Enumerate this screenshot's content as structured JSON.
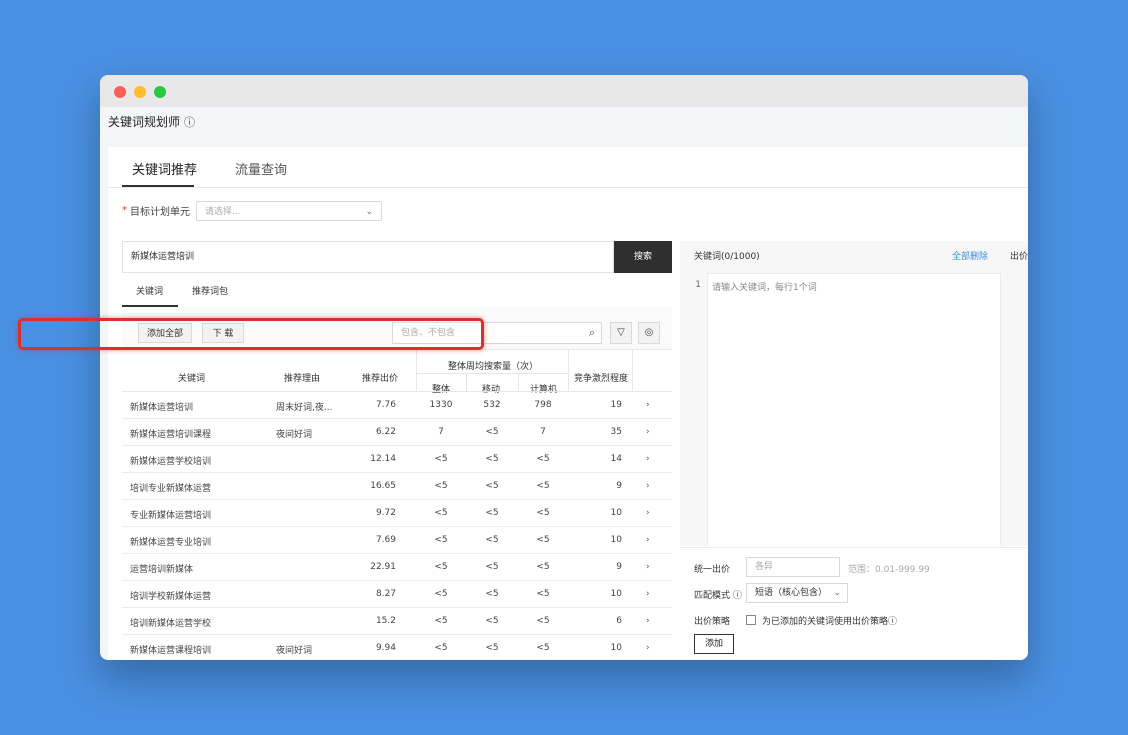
{
  "app": {
    "title": "关键词规划师"
  },
  "tabs": [
    {
      "label": "关键词推荐"
    },
    {
      "label": "流量查询"
    }
  ],
  "target": {
    "label": "目标计划单元",
    "placeholder": "请选择..."
  },
  "search": {
    "value": "新媒体运营培训",
    "button": "搜索"
  },
  "subtabs": [
    {
      "label": "关键词"
    },
    {
      "label": "推荐词包"
    }
  ],
  "toolbar": {
    "add_all": "添加全部",
    "download": "下 载",
    "filter_placeholder": "包含、不包含"
  },
  "table": {
    "headers": {
      "keyword": "关键词",
      "reason": "推荐理由",
      "bid": "推荐出价",
      "weekly": "整体周均搜索量（次）",
      "total": "整体",
      "mobile": "移动",
      "pc": "计算机",
      "competition": "竞争激烈程度"
    },
    "rows": [
      {
        "keyword": "新媒体运营培训",
        "reason": "周末好词,夜...",
        "bid": "7.76",
        "total": "1330",
        "mobile": "532",
        "pc": "798",
        "competition": "19"
      },
      {
        "keyword": "新媒体运营培训课程",
        "reason": "夜间好词",
        "bid": "6.22",
        "total": "7",
        "mobile": "<5",
        "pc": "7",
        "competition": "35"
      },
      {
        "keyword": "新媒体运营学校培训",
        "reason": "",
        "bid": "12.14",
        "total": "<5",
        "mobile": "<5",
        "pc": "<5",
        "competition": "14"
      },
      {
        "keyword": "培训专业新媒体运营",
        "reason": "",
        "bid": "16.65",
        "total": "<5",
        "mobile": "<5",
        "pc": "<5",
        "competition": "9"
      },
      {
        "keyword": "专业新媒体运营培训",
        "reason": "",
        "bid": "9.72",
        "total": "<5",
        "mobile": "<5",
        "pc": "<5",
        "competition": "10"
      },
      {
        "keyword": "新媒体运营专业培训",
        "reason": "",
        "bid": "7.69",
        "total": "<5",
        "mobile": "<5",
        "pc": "<5",
        "competition": "10"
      },
      {
        "keyword": "运营培训新媒体",
        "reason": "",
        "bid": "22.91",
        "total": "<5",
        "mobile": "<5",
        "pc": "<5",
        "competition": "9"
      },
      {
        "keyword": "培训学校新媒体运营",
        "reason": "",
        "bid": "8.27",
        "total": "<5",
        "mobile": "<5",
        "pc": "<5",
        "competition": "10"
      },
      {
        "keyword": "培训新媒体运营学校",
        "reason": "",
        "bid": "15.2",
        "total": "<5",
        "mobile": "<5",
        "pc": "<5",
        "competition": "6"
      },
      {
        "keyword": "新媒体运营课程培训",
        "reason": "夜间好词",
        "bid": "9.94",
        "total": "<5",
        "mobile": "<5",
        "pc": "<5",
        "competition": "10"
      }
    ]
  },
  "right": {
    "header": "关键词(0/1000)",
    "clear_all": "全部删除",
    "bid_col": "出价",
    "line_no": "1",
    "editor_placeholder": "请输入关键词，每行1个词",
    "unified_bid_label": "统一出价",
    "unified_bid_placeholder": "各异",
    "range": "范围：0.01-999.99",
    "match_label": "匹配模式",
    "match_value": "短语（核心包含）",
    "strategy_label": "出价策略",
    "strategy_text": "为已添加的关键词使用出价策略",
    "add": "添加"
  },
  "icons": {
    "info": "info-icon",
    "chevron": "chevron-down-icon",
    "search": "search-icon",
    "filter": "filter-icon",
    "settings": "settings-icon",
    "row_arrow": "chevron-right-icon",
    "help": "help-icon"
  },
  "colors": {
    "background": "#4a90e2",
    "highlight": "#d9322d",
    "search_button": "#2f2f2f",
    "link": "#3a8ee6",
    "required": "#e0342a"
  }
}
